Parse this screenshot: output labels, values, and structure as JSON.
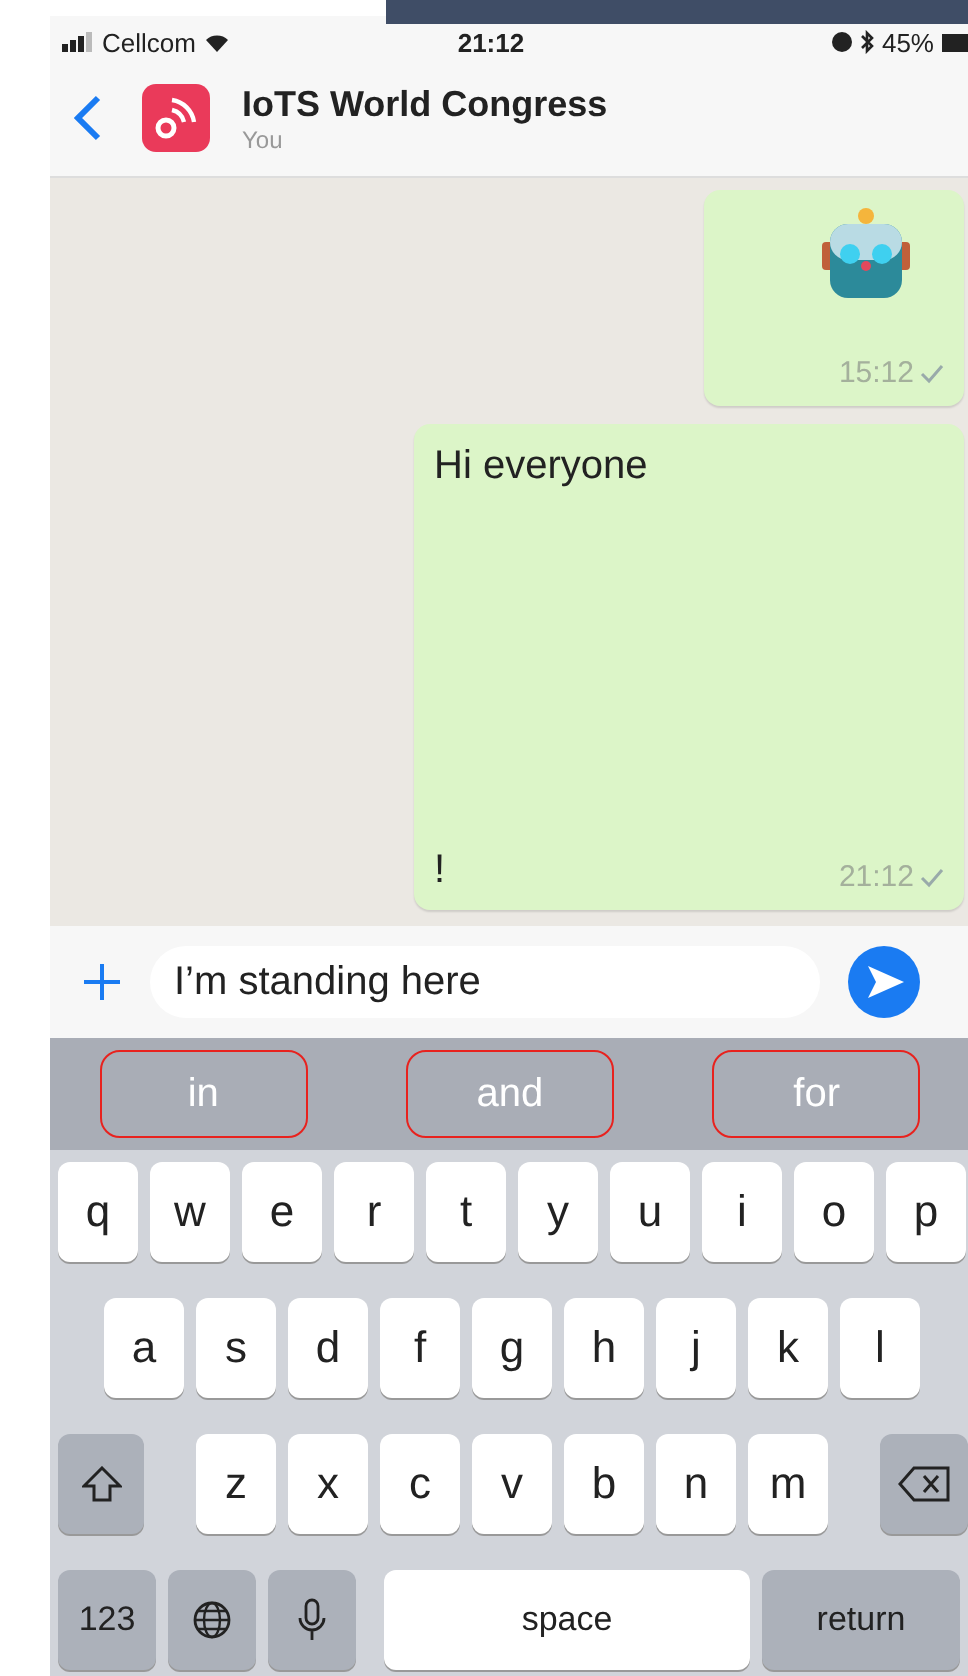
{
  "status_bar": {
    "carrier": "Cellcom",
    "time": "21:12",
    "battery": "45%"
  },
  "header": {
    "title": "IoTS World Congress",
    "subtitle": "You"
  },
  "messages": [
    {
      "kind": "emoji",
      "time": "15:12",
      "delivered": true
    },
    {
      "kind": "text",
      "lines": [
        "Hi everyone",
        "!"
      ],
      "time": "21:12",
      "delivered": true
    }
  ],
  "composer": {
    "value": "I’m standing here"
  },
  "suggestions": [
    {
      "label": "in",
      "annotated": true
    },
    {
      "label": "and",
      "annotated": true
    },
    {
      "label": "for",
      "annotated": true
    }
  ],
  "keyboard": {
    "rows": [
      [
        "q",
        "w",
        "e",
        "r",
        "t",
        "y",
        "u",
        "i",
        "o",
        "p"
      ],
      [
        "a",
        "s",
        "d",
        "f",
        "g",
        "h",
        "j",
        "k",
        "l"
      ],
      [
        "z",
        "x",
        "c",
        "v",
        "b",
        "n",
        "m"
      ]
    ],
    "numbers_key": "123",
    "space_key": "space",
    "return_key": "return"
  }
}
